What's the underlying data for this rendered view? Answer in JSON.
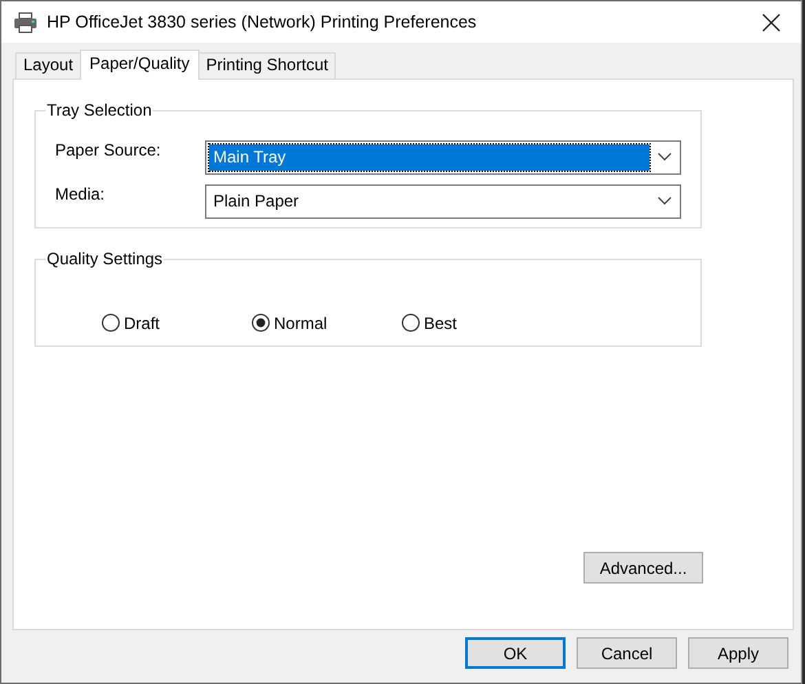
{
  "window": {
    "title": "HP OfficeJet 3830 series (Network) Printing Preferences"
  },
  "tabs": [
    {
      "label": "Layout",
      "selected": false
    },
    {
      "label": "Paper/Quality",
      "selected": true
    },
    {
      "label": "Printing Shortcut",
      "selected": false
    }
  ],
  "tray_selection": {
    "title": "Tray Selection",
    "fields": [
      {
        "label": "Paper Source:",
        "value": "Main Tray",
        "focused": true
      },
      {
        "label": "Media:",
        "value": "Plain Paper",
        "focused": false
      }
    ]
  },
  "quality_settings": {
    "title": "Quality Settings",
    "options": [
      {
        "label": "Draft",
        "selected": false
      },
      {
        "label": "Normal",
        "selected": true
      },
      {
        "label": "Best",
        "selected": false
      }
    ]
  },
  "advanced_button": "Advanced...",
  "buttons": [
    {
      "label": "OK",
      "default": true
    },
    {
      "label": "Cancel",
      "default": false
    },
    {
      "label": "Apply",
      "default": false
    }
  ]
}
